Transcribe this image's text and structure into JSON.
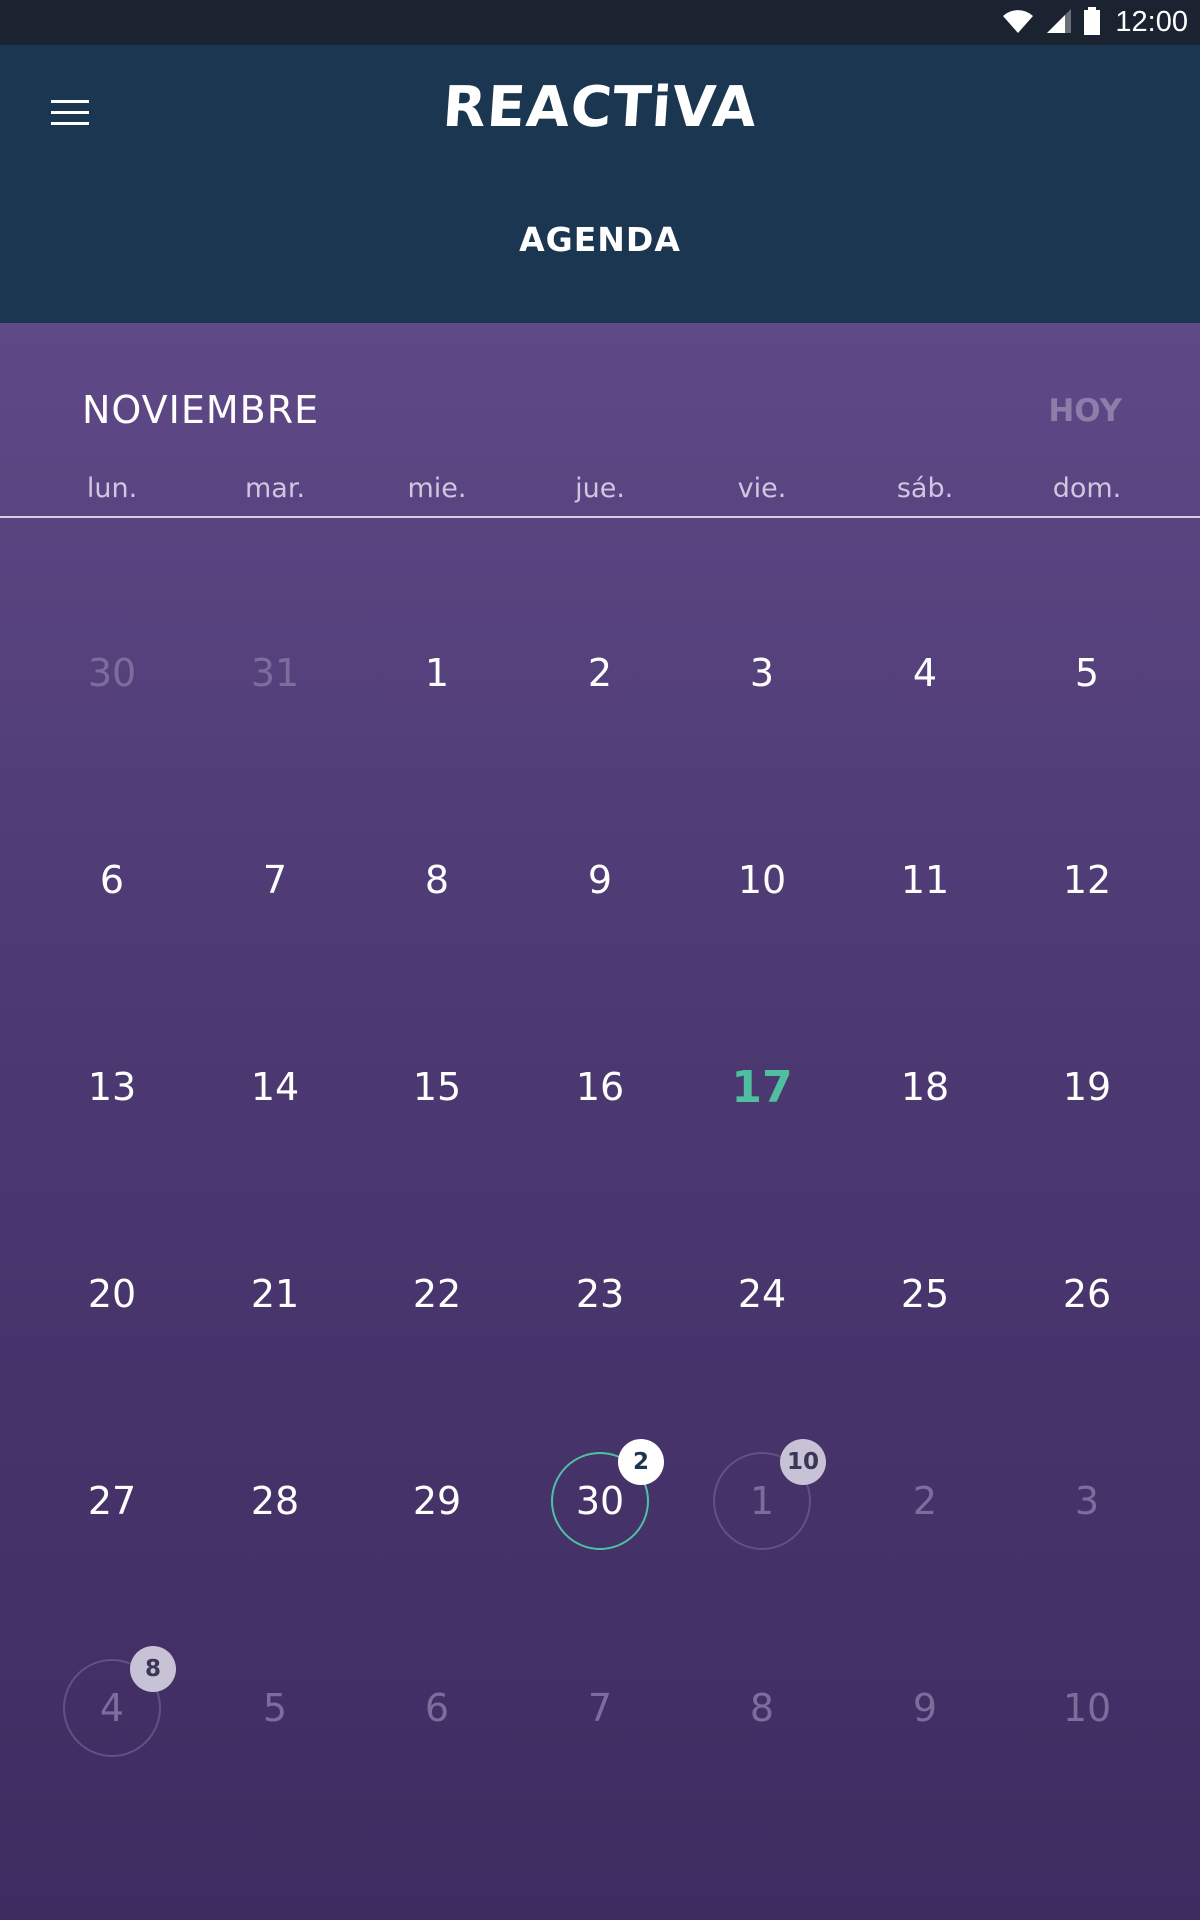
{
  "status_bar": {
    "time": "12:00",
    "icons": [
      "wifi-icon",
      "signal-icon",
      "battery-icon"
    ]
  },
  "header": {
    "logo_text": "REACTiVA",
    "title": "AGENDA",
    "menu_icon": "hamburger-menu-icon"
  },
  "calendar": {
    "month": "NOVIEMBRE",
    "today_label": "HOY",
    "weekdays": [
      "lun.",
      "mar.",
      "mie.",
      "jue.",
      "vie.",
      "sáb.",
      "dom."
    ],
    "weeks": [
      [
        {
          "n": "30",
          "state": "other"
        },
        {
          "n": "31",
          "state": "other"
        },
        {
          "n": "1"
        },
        {
          "n": "2"
        },
        {
          "n": "3"
        },
        {
          "n": "4"
        },
        {
          "n": "5"
        }
      ],
      [
        {
          "n": "6"
        },
        {
          "n": "7"
        },
        {
          "n": "8"
        },
        {
          "n": "9"
        },
        {
          "n": "10"
        },
        {
          "n": "11"
        },
        {
          "n": "12"
        }
      ],
      [
        {
          "n": "13"
        },
        {
          "n": "14"
        },
        {
          "n": "15"
        },
        {
          "n": "16"
        },
        {
          "n": "17",
          "state": "today"
        },
        {
          "n": "18"
        },
        {
          "n": "19"
        }
      ],
      [
        {
          "n": "20"
        },
        {
          "n": "21"
        },
        {
          "n": "22"
        },
        {
          "n": "23"
        },
        {
          "n": "24"
        },
        {
          "n": "25"
        },
        {
          "n": "26"
        }
      ],
      [
        {
          "n": "27"
        },
        {
          "n": "28"
        },
        {
          "n": "29"
        },
        {
          "n": "30",
          "event": "current",
          "badge": "2"
        },
        {
          "n": "1",
          "state": "other",
          "event": "other",
          "badge": "10"
        },
        {
          "n": "2",
          "state": "other"
        },
        {
          "n": "3",
          "state": "other"
        }
      ],
      [
        {
          "n": "4",
          "state": "other",
          "event": "other",
          "badge": "8"
        },
        {
          "n": "5",
          "state": "other"
        },
        {
          "n": "6",
          "state": "other"
        },
        {
          "n": "7",
          "state": "other"
        },
        {
          "n": "8",
          "state": "other"
        },
        {
          "n": "9",
          "state": "other"
        },
        {
          "n": "10",
          "state": "other"
        }
      ]
    ]
  },
  "colors": {
    "header_bg": "#1b3651",
    "status_bg": "#1b2330",
    "calendar_top": "#5f4987",
    "calendar_bottom": "#3e2c61",
    "accent_teal": "#4fbfa0",
    "muted_text": "#7d6d9c"
  }
}
